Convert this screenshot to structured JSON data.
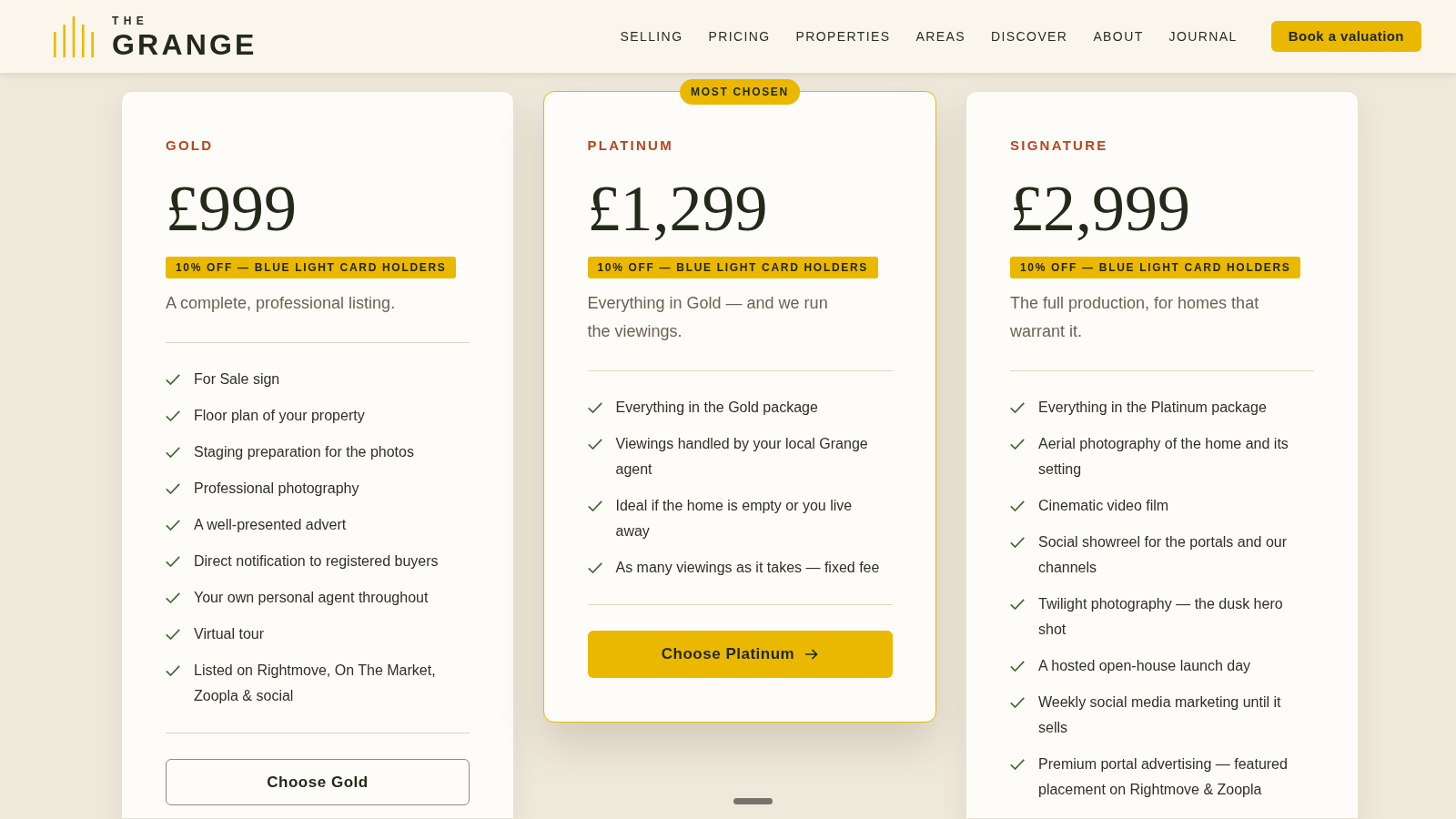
{
  "header": {
    "logo": {
      "overline": "THE",
      "name": "GRANGE"
    },
    "nav": [
      "SELLING",
      "PRICING",
      "PROPERTIES",
      "AREAS",
      "DISCOVER",
      "ABOUT",
      "JOURNAL"
    ],
    "cta": "Book a valuation"
  },
  "plans": [
    {
      "tier": "GOLD",
      "featured": false,
      "price": "£999",
      "offer": "10% OFF — BLUE LIGHT CARD HOLDERS",
      "description": "A complete, professional listing.",
      "features": [
        "For Sale sign",
        "Floor plan of your property",
        "Staging preparation for the photos",
        "Professional photography",
        "A well-presented advert",
        "Direct notification to registered buyers",
        "Your own personal agent throughout",
        "Virtual tour",
        "Listed on Rightmove, On The Market, Zoopla & social"
      ],
      "button": {
        "label": "Choose Gold",
        "kind": "outline"
      }
    },
    {
      "tier": "PLATINUM",
      "featured": true,
      "badge": "MOST CHOSEN",
      "price": "£1,299",
      "offer": "10% OFF — BLUE LIGHT CARD HOLDERS",
      "description": "Everything in Gold — and we run the viewings.",
      "features": [
        "Everything in the Gold package",
        "Viewings handled by your local Grange agent",
        "Ideal if the home is empty or you live away",
        "As many viewings as it takes — fixed fee"
      ],
      "button": {
        "label": "Choose Platinum",
        "kind": "solid",
        "arrow": true
      }
    },
    {
      "tier": "SIGNATURE",
      "featured": false,
      "price": "£2,999",
      "offer": "10% OFF — BLUE LIGHT CARD HOLDERS",
      "description": "The full production, for homes that warrant it.",
      "features": [
        "Everything in the Platinum package",
        "Aerial photography of the home and its setting",
        "Cinematic video film",
        "Social showreel for the portals and our channels",
        "Twilight photography — the dusk hero shot",
        "A hosted open-house launch day",
        "Weekly social media marketing until it sells",
        "Premium portal advertising — featured placement on Rightmove & Zoopla"
      ]
    }
  ]
}
